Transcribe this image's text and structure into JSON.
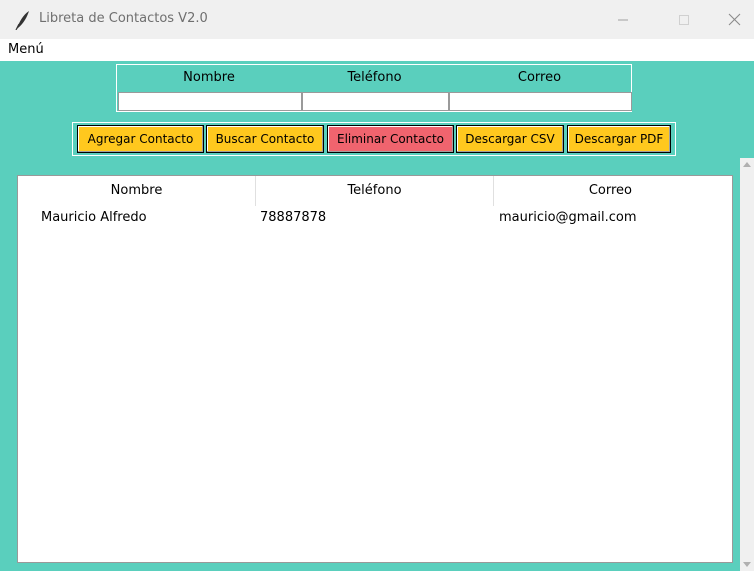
{
  "window": {
    "title": "Libreta de Contactos V2.0",
    "title_icon": "feather-icon",
    "controls": [
      "minimize-icon",
      "maximize-icon",
      "close-icon"
    ]
  },
  "menubar": {
    "items": [
      {
        "label": "Menú"
      }
    ]
  },
  "form": {
    "labels": {
      "nombre": "Nombre",
      "telefono": "Teléfono",
      "correo": "Correo"
    },
    "values": {
      "nombre": "",
      "telefono": "",
      "correo": ""
    }
  },
  "buttons": {
    "agregar": "Agregar Contacto",
    "buscar": "Buscar Contacto",
    "eliminar": "Eliminar Contacto",
    "csv": "Descargar CSV",
    "pdf": "Descargar PDF"
  },
  "table": {
    "columns": [
      "Nombre",
      "Teléfono",
      "Correo"
    ],
    "rows": [
      [
        "Mauricio Alfredo",
        "78887878",
        "mauricio@gmail.com"
      ]
    ]
  },
  "colors": {
    "background": "#5acfbd",
    "button_yellow": "#ffc81e",
    "button_red": "#f0646e"
  }
}
